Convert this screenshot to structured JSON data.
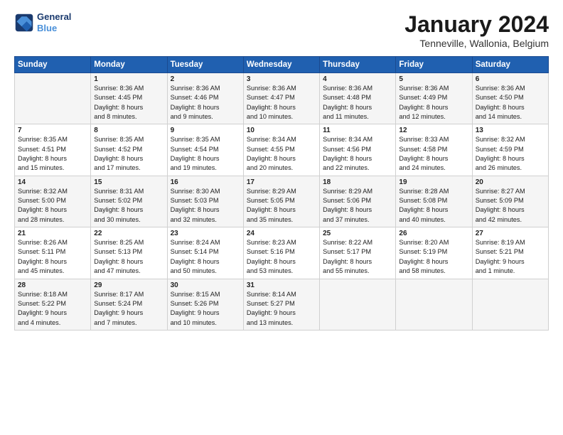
{
  "logo": {
    "line1": "General",
    "line2": "Blue"
  },
  "title": "January 2024",
  "subtitle": "Tenneville, Wallonia, Belgium",
  "headers": [
    "Sunday",
    "Monday",
    "Tuesday",
    "Wednesday",
    "Thursday",
    "Friday",
    "Saturday"
  ],
  "weeks": [
    [
      {
        "day": "",
        "info": ""
      },
      {
        "day": "1",
        "info": "Sunrise: 8:36 AM\nSunset: 4:45 PM\nDaylight: 8 hours\nand 8 minutes."
      },
      {
        "day": "2",
        "info": "Sunrise: 8:36 AM\nSunset: 4:46 PM\nDaylight: 8 hours\nand 9 minutes."
      },
      {
        "day": "3",
        "info": "Sunrise: 8:36 AM\nSunset: 4:47 PM\nDaylight: 8 hours\nand 10 minutes."
      },
      {
        "day": "4",
        "info": "Sunrise: 8:36 AM\nSunset: 4:48 PM\nDaylight: 8 hours\nand 11 minutes."
      },
      {
        "day": "5",
        "info": "Sunrise: 8:36 AM\nSunset: 4:49 PM\nDaylight: 8 hours\nand 12 minutes."
      },
      {
        "day": "6",
        "info": "Sunrise: 8:36 AM\nSunset: 4:50 PM\nDaylight: 8 hours\nand 14 minutes."
      }
    ],
    [
      {
        "day": "7",
        "info": "Sunrise: 8:35 AM\nSunset: 4:51 PM\nDaylight: 8 hours\nand 15 minutes."
      },
      {
        "day": "8",
        "info": "Sunrise: 8:35 AM\nSunset: 4:52 PM\nDaylight: 8 hours\nand 17 minutes."
      },
      {
        "day": "9",
        "info": "Sunrise: 8:35 AM\nSunset: 4:54 PM\nDaylight: 8 hours\nand 19 minutes."
      },
      {
        "day": "10",
        "info": "Sunrise: 8:34 AM\nSunset: 4:55 PM\nDaylight: 8 hours\nand 20 minutes."
      },
      {
        "day": "11",
        "info": "Sunrise: 8:34 AM\nSunset: 4:56 PM\nDaylight: 8 hours\nand 22 minutes."
      },
      {
        "day": "12",
        "info": "Sunrise: 8:33 AM\nSunset: 4:58 PM\nDaylight: 8 hours\nand 24 minutes."
      },
      {
        "day": "13",
        "info": "Sunrise: 8:32 AM\nSunset: 4:59 PM\nDaylight: 8 hours\nand 26 minutes."
      }
    ],
    [
      {
        "day": "14",
        "info": "Sunrise: 8:32 AM\nSunset: 5:00 PM\nDaylight: 8 hours\nand 28 minutes."
      },
      {
        "day": "15",
        "info": "Sunrise: 8:31 AM\nSunset: 5:02 PM\nDaylight: 8 hours\nand 30 minutes."
      },
      {
        "day": "16",
        "info": "Sunrise: 8:30 AM\nSunset: 5:03 PM\nDaylight: 8 hours\nand 32 minutes."
      },
      {
        "day": "17",
        "info": "Sunrise: 8:29 AM\nSunset: 5:05 PM\nDaylight: 8 hours\nand 35 minutes."
      },
      {
        "day": "18",
        "info": "Sunrise: 8:29 AM\nSunset: 5:06 PM\nDaylight: 8 hours\nand 37 minutes."
      },
      {
        "day": "19",
        "info": "Sunrise: 8:28 AM\nSunset: 5:08 PM\nDaylight: 8 hours\nand 40 minutes."
      },
      {
        "day": "20",
        "info": "Sunrise: 8:27 AM\nSunset: 5:09 PM\nDaylight: 8 hours\nand 42 minutes."
      }
    ],
    [
      {
        "day": "21",
        "info": "Sunrise: 8:26 AM\nSunset: 5:11 PM\nDaylight: 8 hours\nand 45 minutes."
      },
      {
        "day": "22",
        "info": "Sunrise: 8:25 AM\nSunset: 5:13 PM\nDaylight: 8 hours\nand 47 minutes."
      },
      {
        "day": "23",
        "info": "Sunrise: 8:24 AM\nSunset: 5:14 PM\nDaylight: 8 hours\nand 50 minutes."
      },
      {
        "day": "24",
        "info": "Sunrise: 8:23 AM\nSunset: 5:16 PM\nDaylight: 8 hours\nand 53 minutes."
      },
      {
        "day": "25",
        "info": "Sunrise: 8:22 AM\nSunset: 5:17 PM\nDaylight: 8 hours\nand 55 minutes."
      },
      {
        "day": "26",
        "info": "Sunrise: 8:20 AM\nSunset: 5:19 PM\nDaylight: 8 hours\nand 58 minutes."
      },
      {
        "day": "27",
        "info": "Sunrise: 8:19 AM\nSunset: 5:21 PM\nDaylight: 9 hours\nand 1 minute."
      }
    ],
    [
      {
        "day": "28",
        "info": "Sunrise: 8:18 AM\nSunset: 5:22 PM\nDaylight: 9 hours\nand 4 minutes."
      },
      {
        "day": "29",
        "info": "Sunrise: 8:17 AM\nSunset: 5:24 PM\nDaylight: 9 hours\nand 7 minutes."
      },
      {
        "day": "30",
        "info": "Sunrise: 8:15 AM\nSunset: 5:26 PM\nDaylight: 9 hours\nand 10 minutes."
      },
      {
        "day": "31",
        "info": "Sunrise: 8:14 AM\nSunset: 5:27 PM\nDaylight: 9 hours\nand 13 minutes."
      },
      {
        "day": "",
        "info": ""
      },
      {
        "day": "",
        "info": ""
      },
      {
        "day": "",
        "info": ""
      }
    ]
  ]
}
